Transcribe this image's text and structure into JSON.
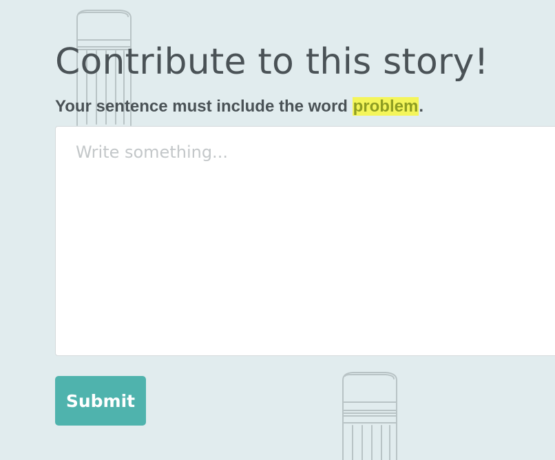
{
  "prompt": {
    "title": "Contribute to this story!",
    "instruction_prefix": "Your sentence must include the word ",
    "required_word": "problem",
    "instruction_suffix": "."
  },
  "editor": {
    "placeholder": "Write something...",
    "value": ""
  },
  "actions": {
    "submit_label": "Submit"
  },
  "colors": {
    "background": "#e1ecee",
    "text": "#4a5256",
    "highlight_bg": "#f4f55a",
    "highlight_text": "#8e9d22",
    "button": "#4fb3ad",
    "button_text": "#ffffff"
  },
  "decorations": [
    "pencil-sketch-icon",
    "pencil-sketch-icon"
  ]
}
